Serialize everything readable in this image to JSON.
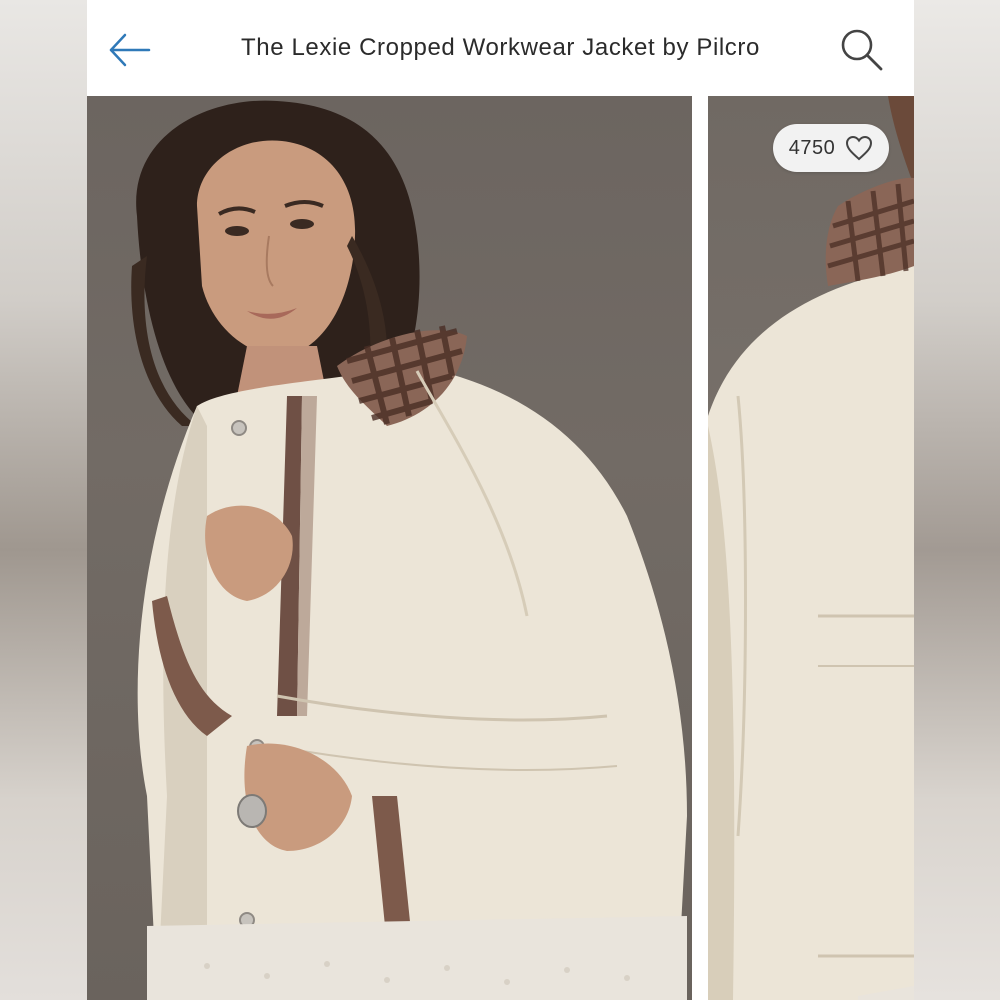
{
  "header": {
    "title": "The Lexie Cropped Workwear Jacket by Pilcro",
    "back_icon": "arrow-left-icon",
    "search_icon": "search-icon"
  },
  "listing": {
    "likes": "4750",
    "like_icon": "heart-outline-icon"
  },
  "colors": {
    "nav_background": "#ffffff",
    "icon_blue": "#2f79b8",
    "photo_background": "#6e6761",
    "jacket_cream": "#ece5d7",
    "gingham_brown": "#5b3d34"
  }
}
